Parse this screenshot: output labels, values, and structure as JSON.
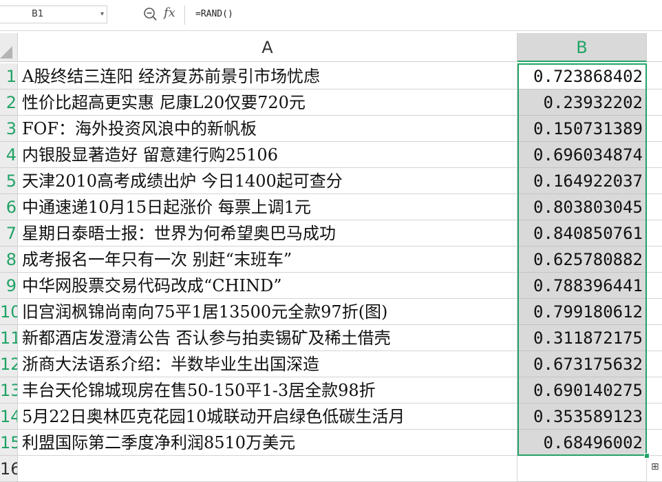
{
  "formula_bar": {
    "name_box": "B1",
    "formula": "=RAND()"
  },
  "columns": {
    "a": "A",
    "b": "B"
  },
  "rows": [
    {
      "num": "1",
      "a": "A股终结三连阳 经济复苏前景引市场忧虑",
      "b": "0.723868402"
    },
    {
      "num": "2",
      "a": "性价比超高更实惠 尼康L20仅要720元",
      "b": "0.23932202"
    },
    {
      "num": "3",
      "a": "FOF：海外投资风浪中的新帆板",
      "b": "0.150731389"
    },
    {
      "num": "4",
      "a": "内银股显著造好 留意建行购25106",
      "b": "0.696034874"
    },
    {
      "num": "5",
      "a": "天津2010高考成绩出炉 今日1400起可查分",
      "b": "0.164922037"
    },
    {
      "num": "6",
      "a": "中通速递10月15日起涨价 每票上调1元",
      "b": "0.803803045"
    },
    {
      "num": "7",
      "a": "星期日泰晤士报：世界为何希望奥巴马成功",
      "b": "0.840850761"
    },
    {
      "num": "8",
      "a": "成考报名一年只有一次 别赶“末班车”",
      "b": "0.625780882"
    },
    {
      "num": "9",
      "a": "中华网股票交易代码改成“CHIND”",
      "b": "0.788396441"
    },
    {
      "num": "10",
      "a": "旧宫润枫锦尚南向75平1居13500元全款97折(图)",
      "b": "0.799180612"
    },
    {
      "num": "11",
      "a": "新都酒店发澄清公告 否认参与拍卖锡矿及稀土借壳",
      "b": "0.311872175"
    },
    {
      "num": "12",
      "a": "浙商大法语系介绍：半数毕业生出国深造",
      "b": "0.673175632"
    },
    {
      "num": "13",
      "a": "丰台天伦锦城现房在售50-150平1-3居全款98折",
      "b": "0.690140275"
    },
    {
      "num": "14",
      "a": "5月22日奥林匹克花园10城联动开启绿色低碳生活月",
      "b": "0.353589123"
    },
    {
      "num": "15",
      "a": "利盟国际第二季度净利润8510万美元",
      "b": "0.68496002"
    },
    {
      "num": "16",
      "a": "",
      "b": ""
    }
  ],
  "colors": {
    "accent": "#21a366",
    "selected_fill": "#d9d9d9"
  }
}
